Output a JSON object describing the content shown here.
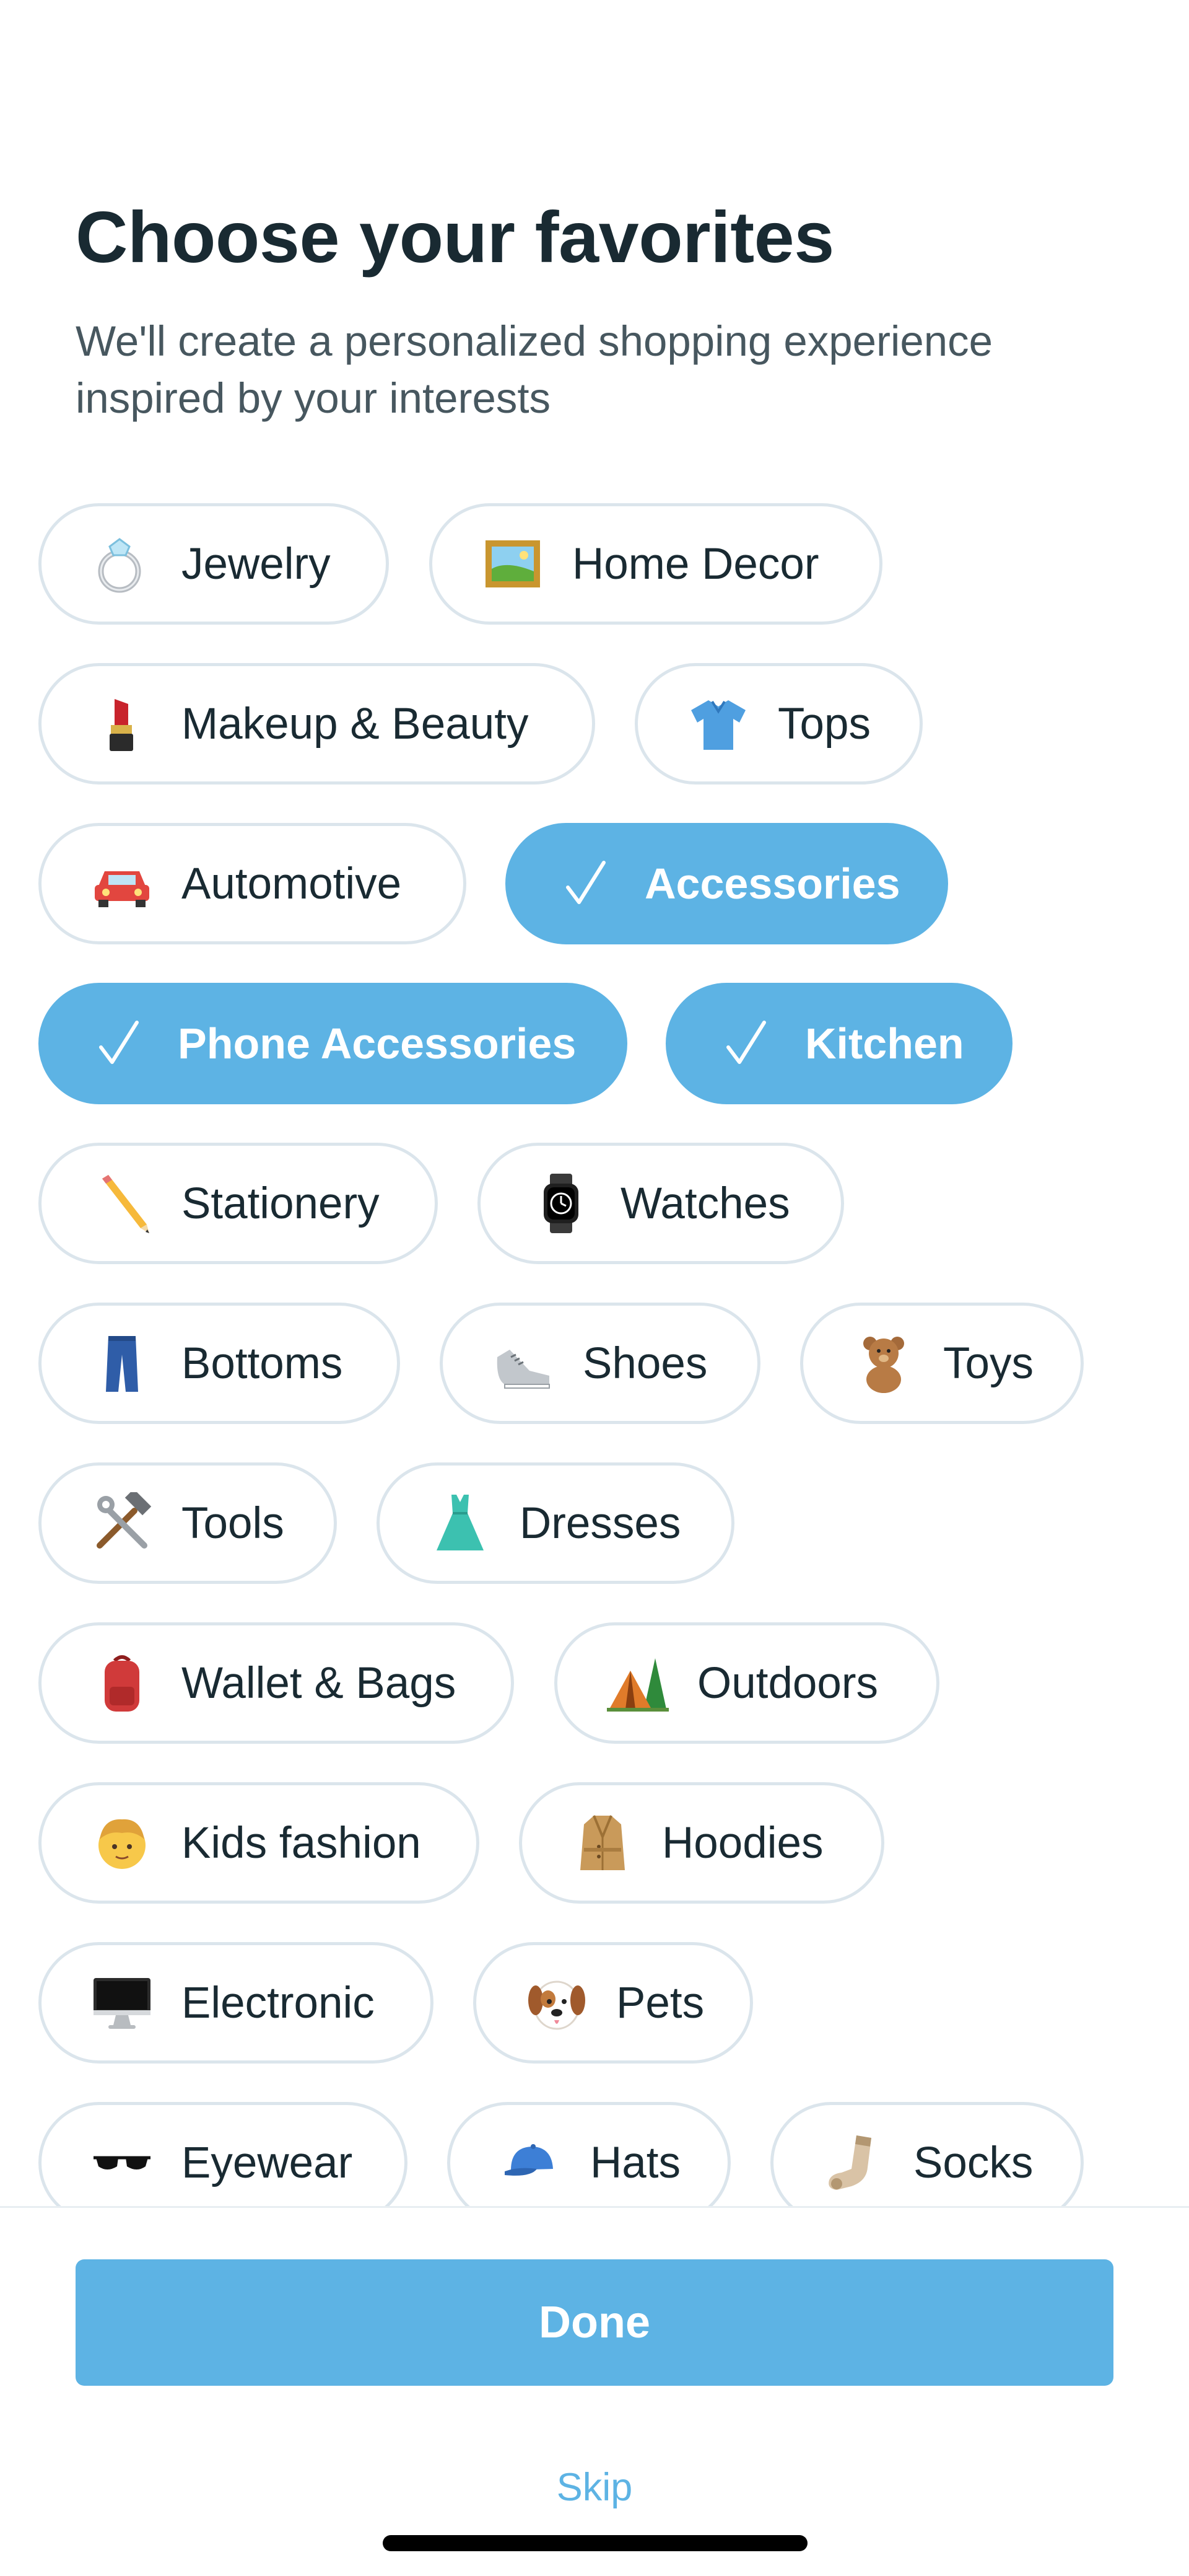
{
  "header": {
    "title": "Choose your favorites",
    "subtitle": "We'll create a personalized shopping experience inspired by your interests"
  },
  "categories": [
    {
      "label": "Jewelry",
      "icon": "ring-icon",
      "selected": false
    },
    {
      "label": "Home Decor",
      "icon": "framed-picture-icon",
      "selected": false
    },
    {
      "label": "Makeup & Beauty",
      "icon": "lipstick-icon",
      "selected": false
    },
    {
      "label": "Tops",
      "icon": "shirt-icon",
      "selected": false
    },
    {
      "label": "Automotive",
      "icon": "car-icon",
      "selected": false
    },
    {
      "label": "Accessories",
      "icon": "checkmark-icon",
      "selected": true
    },
    {
      "label": "Phone Accessories",
      "icon": "checkmark-icon",
      "selected": true
    },
    {
      "label": "Kitchen",
      "icon": "checkmark-icon",
      "selected": true
    },
    {
      "label": "Stationery",
      "icon": "pencil-icon",
      "selected": false
    },
    {
      "label": "Watches",
      "icon": "watch-icon",
      "selected": false
    },
    {
      "label": "Bottoms",
      "icon": "jeans-icon",
      "selected": false
    },
    {
      "label": "Shoes",
      "icon": "sneaker-icon",
      "selected": false
    },
    {
      "label": "Toys",
      "icon": "teddy-bear-icon",
      "selected": false
    },
    {
      "label": "Tools",
      "icon": "hammer-wrench-icon",
      "selected": false
    },
    {
      "label": "Dresses",
      "icon": "dress-icon",
      "selected": false
    },
    {
      "label": "Wallet & Bags",
      "icon": "backpack-icon",
      "selected": false
    },
    {
      "label": "Outdoors",
      "icon": "tent-icon",
      "selected": false
    },
    {
      "label": "Kids fashion",
      "icon": "boy-icon",
      "selected": false
    },
    {
      "label": "Hoodies",
      "icon": "coat-icon",
      "selected": false
    },
    {
      "label": "Electronic",
      "icon": "desktop-computer-icon",
      "selected": false
    },
    {
      "label": "Pets",
      "icon": "dog-icon",
      "selected": false
    },
    {
      "label": "Eyewear",
      "icon": "sunglasses-icon",
      "selected": false
    },
    {
      "label": "Hats",
      "icon": "cap-icon",
      "selected": false
    },
    {
      "label": "Socks",
      "icon": "sock-icon",
      "selected": false
    }
  ],
  "footer": {
    "done_label": "Done",
    "skip_label": "Skip"
  },
  "colors": {
    "accent": "#5db3e4",
    "pill_border": "#dbe5ec",
    "title": "#192a32",
    "subtitle": "#47575f"
  }
}
